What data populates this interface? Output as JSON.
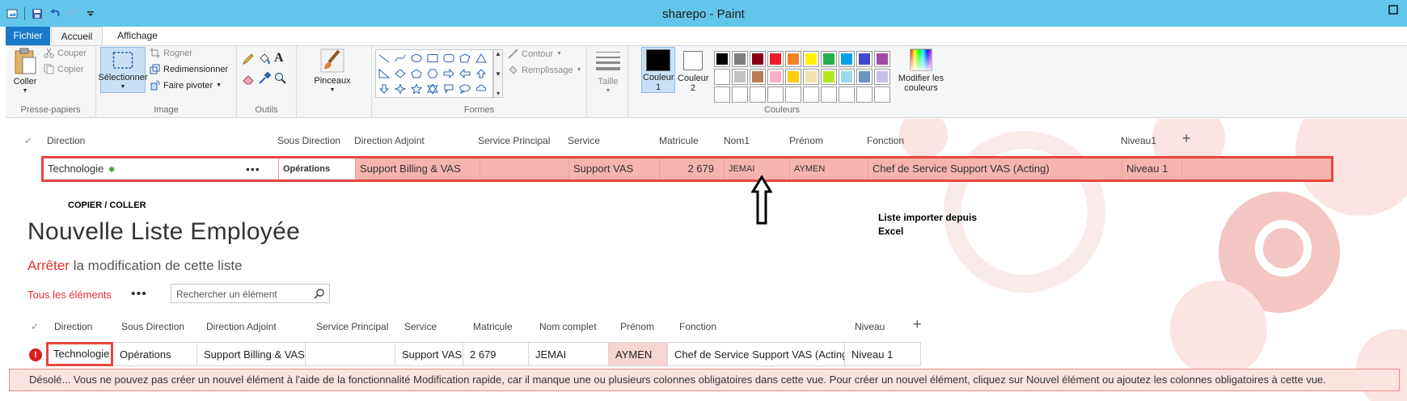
{
  "window": {
    "title": "sharepo - Paint",
    "qat_icons": [
      "save-icon",
      "undo-icon",
      "redo-icon",
      "customize-icon"
    ],
    "controls": [
      "minimize-icon",
      "maximize-icon",
      "close-icon"
    ]
  },
  "ribbon": {
    "tabs": [
      "Fichier",
      "Accueil",
      "Affichage"
    ],
    "clipboard": {
      "paste": "Coller",
      "cut": "Couper",
      "copy": "Copier",
      "label": "Presse-papiers"
    },
    "image": {
      "select": "Sélectionner",
      "crop": "Rogner",
      "resize": "Redimensionner",
      "rotate": "Faire pivoter",
      "label": "Image"
    },
    "tools": {
      "label": "Outils"
    },
    "brushes": {
      "label": "Pinceaux"
    },
    "shapes": {
      "outline": "Contour",
      "fill": "Remplissage",
      "label": "Formes"
    },
    "size": {
      "label": "Taille"
    },
    "colors": {
      "color1": "Couleur 1",
      "color2": "Couleur 2",
      "edit": "Modifier les couleurs",
      "label": "Couleurs",
      "color1_value": "#000000",
      "color2_value": "#ffffff",
      "palette": [
        "#000000",
        "#7f7f7f",
        "#880015",
        "#ed1c24",
        "#ff7f27",
        "#fff200",
        "#22b14c",
        "#00a2e8",
        "#3f48cc",
        "#a349a4",
        "#ffffff",
        "#c3c3c3",
        "#b97a57",
        "#ffaec9",
        "#ffc90e",
        "#efe4b0",
        "#b5e61d",
        "#99d9ea",
        "#7092be",
        "#c8bfe7",
        "",
        "",
        "",
        "",
        "",
        "",
        "",
        "",
        "",
        ""
      ]
    }
  },
  "grid1": {
    "headers": [
      "Direction",
      "Sous Direction",
      "Direction Adjoint",
      "Service Principal",
      "Service",
      "Matricule",
      "Nom1",
      "Prénom",
      "Fonction",
      "Niveau1"
    ],
    "row": {
      "direction": "Technologie",
      "sous_direction": "Opérations",
      "direction_adjoint": "Support Billing & VAS",
      "service_principal": "",
      "service": "Support VAS",
      "matricule": "2 679",
      "nom1": "JEMAI",
      "prenom": "AYMEN",
      "fonction": "Chef de Service Support VAS (Acting)",
      "niveau1": "Niveau 1"
    }
  },
  "annotations": {
    "copy_paste": "COPIER / COLLER",
    "excel_line1": "Liste importer depuis",
    "excel_line2": "Excel"
  },
  "list": {
    "title": "Nouvelle Liste Employée",
    "stop": "Arrêter",
    "stop_rest": "la modification de cette liste",
    "view_all": "Tous les éléments",
    "search_placeholder": "Rechercher un élément"
  },
  "grid2": {
    "headers": [
      "Direction",
      "Sous Direction",
      "Direction Adjoint",
      "Service Principal",
      "Service",
      "Matricule",
      "Nom complet",
      "Prénom",
      "Fonction",
      "Niveau"
    ],
    "row": {
      "direction": "Technologie",
      "sous_direction": "Opérations",
      "direction_adjoint": "Support Billing & VAS",
      "service_principal": "",
      "service": "Support VAS",
      "matricule": "2 679",
      "nom_complet": "JEMAI",
      "prenom": "AYMEN",
      "fonction": "Chef de Service Support VAS (Acting)",
      "niveau": "Niveau 1"
    }
  },
  "error": {
    "message": "Désolé... Vous ne pouvez pas créer un nouvel élément à l'aide de la fonctionnalité Modification rapide, car il manque une ou plusieurs colonnes obligatoires dans cette vue. Pour créer un nouvel élément, cliquez sur Nouvel élément ou ajoutez les colonnes obligatoires à cette vue."
  }
}
